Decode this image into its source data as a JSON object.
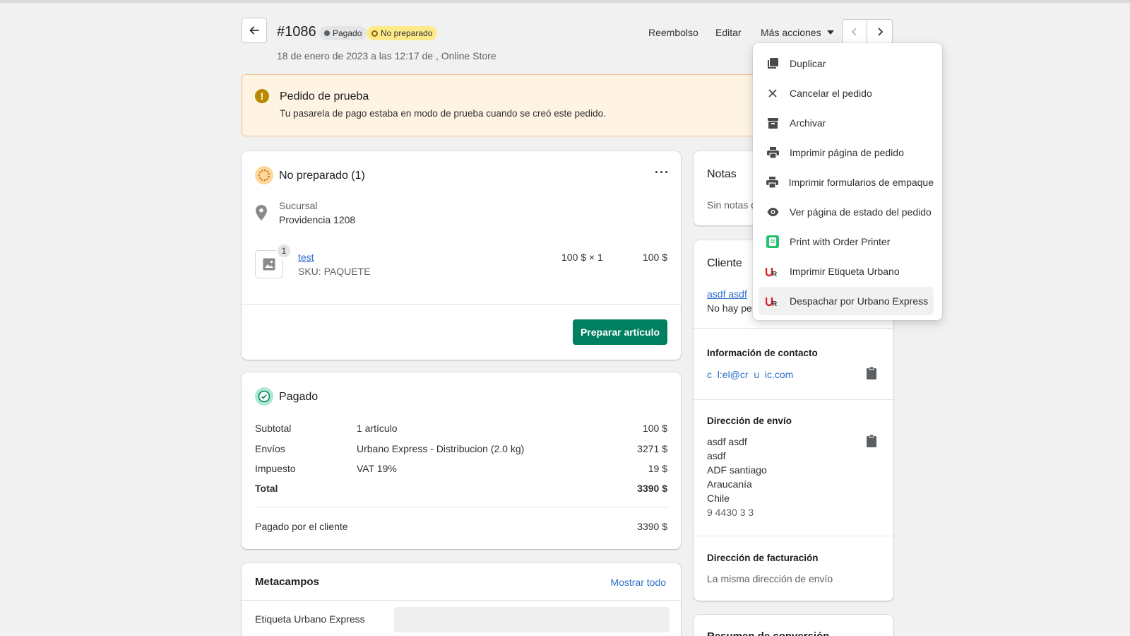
{
  "header": {
    "order_number": "#1086",
    "badge_paid": "Pagado",
    "badge_unfulfilled": "No preparado",
    "subtitle": "18 de enero de 2023 a las 12:17 de , Online Store",
    "refund_label": "Reembolso",
    "edit_label": "Editar",
    "more_actions_label": "Más acciones"
  },
  "banner": {
    "title": "Pedido de prueba",
    "text": "Tu pasarela de pago estaba en modo de prueba cuando se creó este pedido."
  },
  "fulfillment": {
    "title": "No preparado (1)",
    "location_label": "Sucursal",
    "location_value": "Providencia 1208",
    "item": {
      "name": "test",
      "sku": "SKU: PAQUETE",
      "qty_badge": "1",
      "unit_price": "100 $ × 1",
      "total": "100 $"
    },
    "fulfill_button": "Preparar artículo"
  },
  "payment": {
    "title": "Pagado",
    "rows": [
      {
        "label": "Subtotal",
        "desc": "1 artículo",
        "amount": "100 $"
      },
      {
        "label": "Envíos",
        "desc": "Urbano Express - Distribucion (2.0 kg)",
        "amount": "3271 $"
      },
      {
        "label": "Impuesto",
        "desc": "VAT 19%",
        "amount": "19 $"
      },
      {
        "label": "Total",
        "desc": "",
        "amount": "3390 $"
      }
    ],
    "paid_by_label": "Pagado por el cliente",
    "paid_by_amount": "3390 $"
  },
  "metafields": {
    "title": "Metacampos",
    "show_all": "Mostrar todo",
    "field_label": "Etiqueta Urbano Express"
  },
  "notes": {
    "title": "Notas",
    "text": "Sin notas d"
  },
  "customer": {
    "title": "Cliente",
    "name": "asdf asdf",
    "orders_text": "No hay pe",
    "contact_title": "Información de contacto",
    "email": "c  l:el@cr  u  ic.com",
    "shipping_title": "Dirección de envío",
    "shipping_lines": [
      "asdf asdf",
      "asdf",
      "ADF santiago",
      "Araucanía",
      "Chile",
      "9 4430 3 3"
    ],
    "billing_title": "Dirección de facturación",
    "billing_text": "La misma dirección de envío",
    "conversion_title": "Resumen de conversión"
  },
  "menu": {
    "items": [
      {
        "label": "Duplicar",
        "icon": "duplicate-icon"
      },
      {
        "label": "Cancelar el pedido",
        "icon": "close-icon"
      },
      {
        "label": "Archivar",
        "icon": "archive-icon"
      },
      {
        "label": "Imprimir página de pedido",
        "icon": "printer-icon"
      },
      {
        "label": "Imprimir formularios de empaque",
        "icon": "printer-icon"
      },
      {
        "label": "Ver página de estado del pedido",
        "icon": "eye-icon"
      },
      {
        "label": "Print with Order Printer",
        "icon": "order-printer-app-icon"
      },
      {
        "label": "Imprimir Etiqueta Urbano",
        "icon": "urbano-logo-icon"
      },
      {
        "label": "Despachar por Urbano Express",
        "icon": "urbano-logo-icon"
      }
    ]
  },
  "colors": {
    "primary_button": "#008060",
    "banner_bg": "#fff4e4",
    "banner_border": "#f0c38f",
    "warning_icon": "#b98900",
    "unfulfilled_badge_bg": "#ffea8a",
    "paid_badge_bg": "#e4e5e7",
    "link": "#2c6ecb",
    "menu_hover": "#f1f1f1"
  }
}
